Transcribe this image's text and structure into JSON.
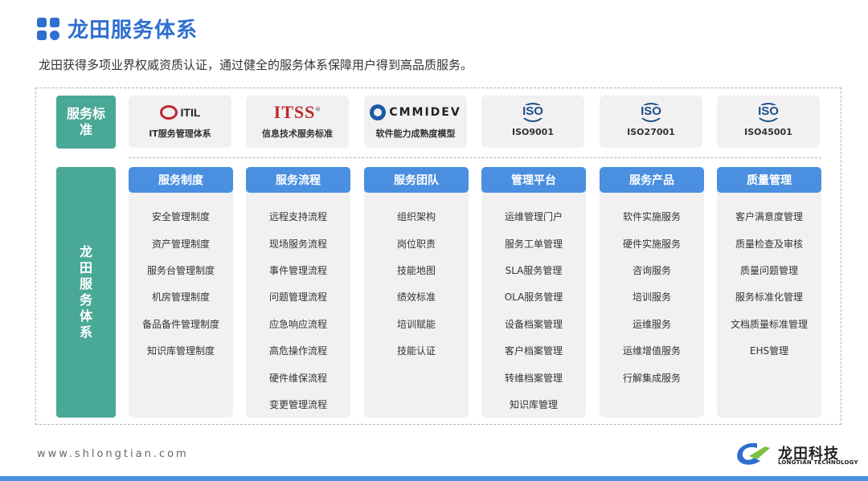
{
  "header": {
    "title": "龙田服务体系",
    "subtitle": "龙田获得多项业界权威资质认证，通过健全的服务体系保障用户得到高品质服务。"
  },
  "side_labels": {
    "top": "服务标准",
    "bottom": "龙田服务体系"
  },
  "certifications": [
    {
      "logo_text": "ITIL",
      "name": "IT服务管理体系",
      "icon": "itil-logo-icon"
    },
    {
      "logo_text": "ITSS",
      "logo_mark": "®",
      "name": "信息技术服务标准",
      "icon": "itss-logo-icon"
    },
    {
      "logo_text": "CMMIDEV",
      "name": "软件能力成熟度模型",
      "icon": "cmmi-logo-icon"
    },
    {
      "logo_text": "ISO",
      "name": "ISO9001",
      "icon": "iso-logo-icon"
    },
    {
      "logo_text": "ISO",
      "name": "ISO27001",
      "icon": "iso-logo-icon"
    },
    {
      "logo_text": "ISO",
      "name": "ISO45001",
      "icon": "iso-logo-icon"
    }
  ],
  "columns": [
    {
      "title": "服务制度",
      "items": [
        "安全管理制度",
        "资产管理制度",
        "服务台管理制度",
        "机房管理制度",
        "备品备件管理制度",
        "知识库管理制度"
      ]
    },
    {
      "title": "服务流程",
      "items": [
        "远程支持流程",
        "现场服务流程",
        "事件管理流程",
        "问题管理流程",
        "应急响应流程",
        "高危操作流程",
        "硬件维保流程",
        "变更管理流程"
      ]
    },
    {
      "title": "服务团队",
      "items": [
        "组织架构",
        "岗位职责",
        "技能地图",
        "绩效标准",
        "培训赋能",
        "技能认证"
      ]
    },
    {
      "title": "管理平台",
      "items": [
        "运维管理门户",
        "服务工单管理",
        "SLA服务管理",
        "OLA服务管理",
        "设备档案管理",
        "客户档案管理",
        "转维档案管理",
        "知识库管理"
      ]
    },
    {
      "title": "服务产品",
      "items": [
        "软件实施服务",
        "硬件实施服务",
        "咨询服务",
        "培训服务",
        "运维服务",
        "运维增值服务",
        "行解集成服务"
      ]
    },
    {
      "title": "质量管理",
      "items": [
        "客户满意度管理",
        "质量检查及审核",
        "质量问题管理",
        "服务标准化管理",
        "文档质量标准管理",
        "EHS管理"
      ]
    }
  ],
  "footer": {
    "website": "www.shlongtian.com",
    "brand_cn": "龙田科技",
    "brand_en": "LONGTIAN TECHNOLOGY"
  },
  "colors": {
    "title_blue": "#2f6fd0",
    "header_blue": "#4a8fe0",
    "label_green": "#4aa897",
    "card_grey": "#f1f1f1",
    "iso_blue": "#1e4e8c",
    "logo_red": "#c0282d"
  }
}
